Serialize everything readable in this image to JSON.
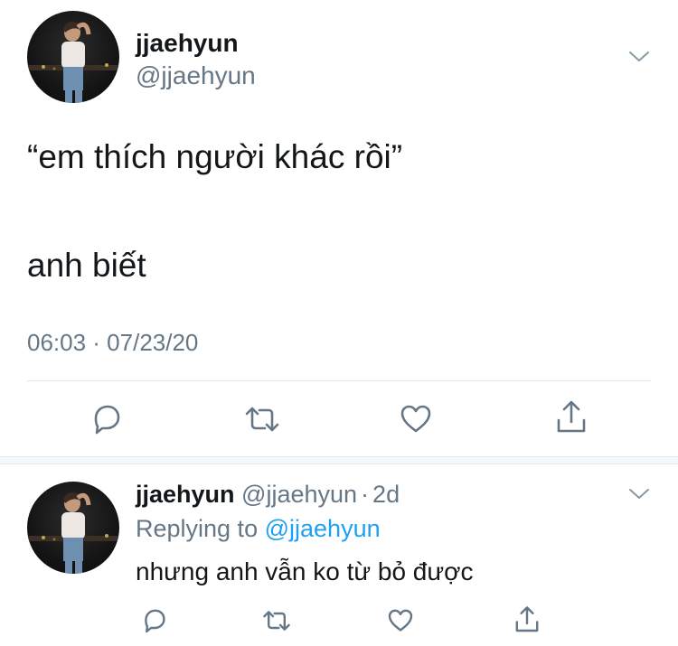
{
  "main_tweet": {
    "display_name": "jjaehyun",
    "handle": "@jjaehyun",
    "text_line1": "“em thích người khác rồi”",
    "text_line2": "anh biết",
    "timestamp": "06:03 · 07/23/20",
    "icons": {
      "reply": "comment-icon",
      "retweet": "retweet-icon",
      "like": "heart-icon",
      "share": "share-icon",
      "menu": "chevron-down-icon"
    }
  },
  "reply_tweet": {
    "display_name": "jjaehyun",
    "handle": "@jjaehyun",
    "dot": "·",
    "age": "2d",
    "replying_prefix": "Replying to",
    "replying_to": "@jjaehyun",
    "text": "nhưng anh vẫn ko từ bỏ được"
  },
  "colors": {
    "text": "#14171a",
    "secondary": "#657786",
    "link": "#1da1f2",
    "icon": "#657786",
    "divider": "#e1e8ed"
  }
}
